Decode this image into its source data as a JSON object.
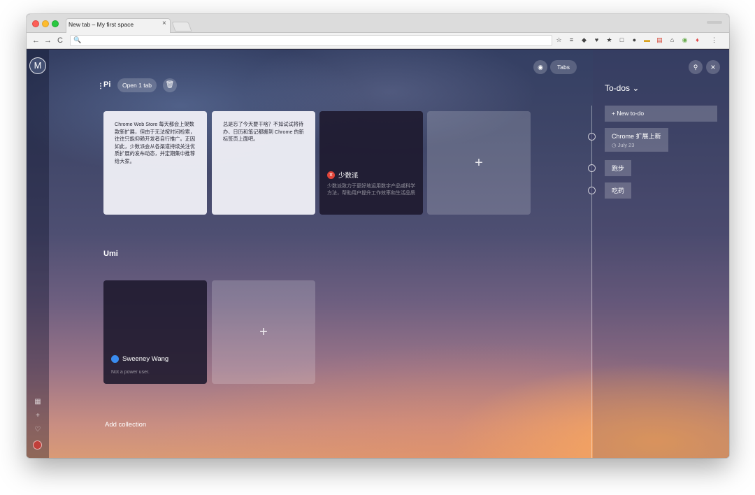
{
  "browser": {
    "tab_title": "New tab – My first space",
    "tab_close": "×",
    "nav_back": "←",
    "nav_forward": "→",
    "nav_reload": "C",
    "omnibox_search_glyph": "🔍",
    "extensions": [
      "☆",
      "≡",
      "◆",
      "♥",
      "★",
      "□",
      "●",
      "▬",
      "▤",
      "⌂",
      "◉",
      "♦",
      "⋮"
    ]
  },
  "sidebar": {
    "avatar_letter": "M",
    "icons": [
      "▦",
      "+",
      "♡"
    ]
  },
  "header": {
    "tabs_label": "Tabs",
    "tabs_icon": "◉",
    "pin_icon": "⚲",
    "close_icon": "×"
  },
  "collections": [
    {
      "name": "Pi",
      "handle": "⋮",
      "open_tabs_label": "Open 1 tab",
      "delete_icon": "🗑",
      "cards": [
        {
          "text": "Chrome Web Store 每天都会上架数款新扩展，但由于无法按时间检索，往往只能仰赖开发者自行推广。正因如此，少数派会从各渠道持续关注优质扩展的发布动态，并定期集中推荐给大家。"
        },
        {
          "text": "总是忘了今天要干啥？不如试试将待办、日历和笔记都搬到 Chrome 的新标签页上面吧。"
        },
        {
          "title": "少数派",
          "icon": "π",
          "desc": "少数派致力于更好地运用数字产品或科学方法，帮助用户提升工作效率和生活品质"
        }
      ],
      "add_label": "+"
    },
    {
      "name": "Umi",
      "cards": [
        {
          "title": "Sweeney Wang",
          "desc": "Not a power user."
        }
      ],
      "add_label": "+"
    }
  ],
  "add_collection_label": "Add collection",
  "todos": {
    "header": "To-dos ⌄",
    "new_label": "+ New to-do",
    "items": [
      {
        "title": "Chrome 扩展上新",
        "date": "◷ July 23"
      },
      {
        "title": "跑步"
      },
      {
        "title": "吃药"
      }
    ]
  },
  "colors": {
    "accent_card_icon": "#e0453a",
    "user_avatar": "#3a8cf0"
  }
}
